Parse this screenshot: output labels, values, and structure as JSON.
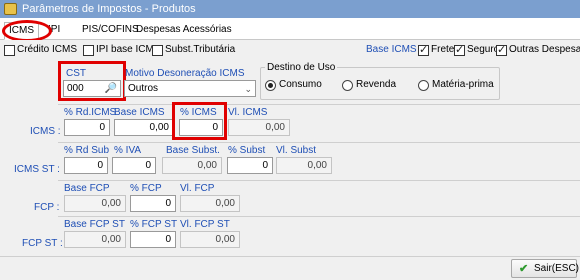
{
  "window": {
    "title": "Parâmetros de Impostos - Produtos"
  },
  "tabs": [
    {
      "label": "ICMS"
    },
    {
      "label": "IPI"
    },
    {
      "label": "PIS/COFINS"
    },
    {
      "label": "Despesas Acessórias"
    }
  ],
  "options": {
    "credito_icms": {
      "label": "Crédito ICMS",
      "checked": false
    },
    "ipi_base_icms": {
      "label": "IPI base ICMS",
      "checked": false
    },
    "subst_tributaria": {
      "label": "Subst.Tributária",
      "checked": false
    }
  },
  "base_icms": {
    "label": "Base ICMS :",
    "frete": {
      "label": "Frete",
      "checked": true
    },
    "seguro": {
      "label": "Seguro",
      "checked": true
    },
    "outras": {
      "label": "Outras Despesas",
      "checked": true
    }
  },
  "cst": {
    "label": "CST",
    "value": "000"
  },
  "motivo": {
    "label": "Motivo Desoneração ICMS",
    "value": "Outros"
  },
  "destino": {
    "label": "Destino de Uso",
    "options": [
      {
        "label": "Consumo",
        "selected": true
      },
      {
        "label": "Revenda",
        "selected": false
      },
      {
        "label": "Matéria-prima",
        "selected": false
      }
    ]
  },
  "icms": {
    "row_label": "ICMS :",
    "rd_label": "% Rd.ICMS",
    "rd_value": "0",
    "base_label": "Base ICMS",
    "base_value": "0,00",
    "pct_label": "% ICMS",
    "pct_value": "0",
    "vl_label": "Vl. ICMS",
    "vl_value": "0,00"
  },
  "icms_st": {
    "row_label": "ICMS ST :",
    "rdsub_label": "% Rd Sub",
    "rdsub_value": "0",
    "iva_label": "% IVA",
    "iva_value": "0",
    "basesubst_label": "Base Subst.",
    "basesubst_value": "0,00",
    "subst_label": "% Subst",
    "subst_value": "0",
    "vlsubst_label": "Vl. Subst",
    "vlsubst_value": "0,00"
  },
  "fcp": {
    "row_label": "FCP :",
    "base_label": "Base FCP",
    "base_value": "0,00",
    "pct_label": "% FCP",
    "pct_value": "0",
    "vl_label": "Vl. FCP",
    "vl_value": "0,00"
  },
  "fcp_st": {
    "row_label": "FCP ST :",
    "base_label": "Base FCP ST",
    "base_value": "0,00",
    "pct_label": "% FCP ST",
    "pct_value": "0",
    "vl_label": "Vl. FCP ST",
    "vl_value": "0,00"
  },
  "footer": {
    "sair_label": "Sair(ESC)"
  },
  "colors": {
    "label_blue": "#1f4fb5",
    "highlight": "#e00000",
    "title_bar": "#7b9fcf",
    "sair_check": "#2e9a2e"
  }
}
